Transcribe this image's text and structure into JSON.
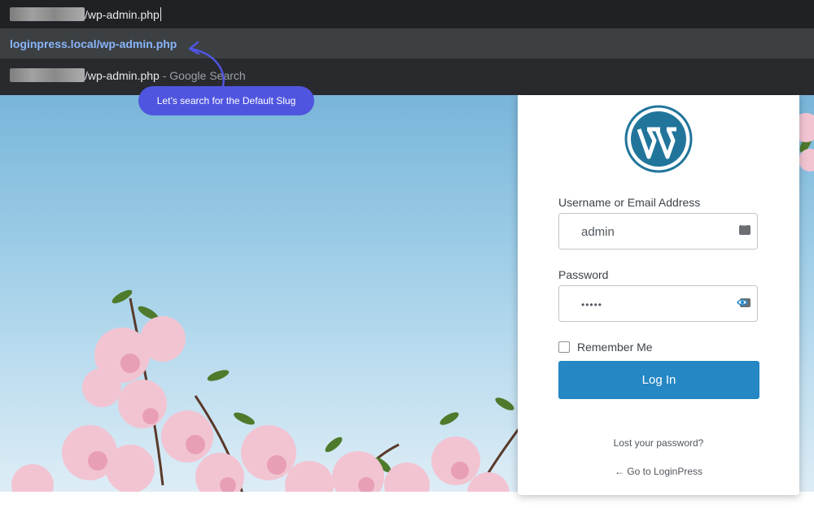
{
  "browser": {
    "address_host_blurred": "loginpress.local",
    "address_path": "/wp-admin.php",
    "suggestions": [
      {
        "url": "loginpress.local/wp-admin.php"
      },
      {
        "url_path": "/wp-admin.php",
        "separator": " - ",
        "engine": "Google Search"
      }
    ]
  },
  "callout": {
    "text": "Let’s search for the Default  Slug"
  },
  "login": {
    "logo": "wordpress-logo",
    "username_label": "Username or Email Address",
    "username_value": "admin",
    "password_label": "Password",
    "password_value": "•••••",
    "remember_label": "Remember Me",
    "login_button": "Log In",
    "lost_password": "Lost your password?",
    "go_to": "← Go to LoginPress"
  },
  "colors": {
    "accent": "#2587c4",
    "callout": "#4f55df",
    "suggest_link": "#8ab4f8"
  }
}
